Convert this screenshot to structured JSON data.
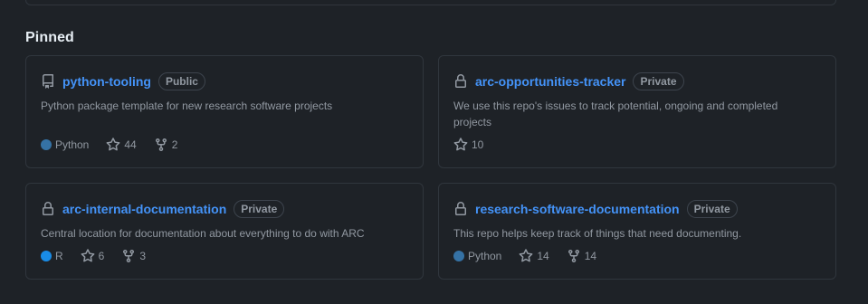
{
  "section": {
    "title": "Pinned"
  },
  "colors": {
    "link": "#4493f8",
    "python": "#3572A5",
    "r": "#198CE7",
    "muted": "#9198a1"
  },
  "repos": [
    {
      "name": "python-tooling",
      "visibility": "Public",
      "icon": "repo-icon",
      "description": "Python package template for new research software projects",
      "language": "Python",
      "language_color": "#3572A5",
      "stars": "44",
      "forks": "2"
    },
    {
      "name": "arc-opportunities-tracker",
      "visibility": "Private",
      "icon": "lock-icon",
      "description": "We use this repo's issues to track potential, ongoing and completed projects",
      "stars": "10"
    },
    {
      "name": "arc-internal-documentation",
      "visibility": "Private",
      "icon": "lock-icon",
      "description": "Central location for documentation about everything to do with ARC",
      "language": "R",
      "language_color": "#198CE7",
      "stars": "6",
      "forks": "3"
    },
    {
      "name": "research-software-documentation",
      "visibility": "Private",
      "icon": "lock-icon",
      "description": "This repo helps keep track of things that need documenting.",
      "language": "Python",
      "language_color": "#3572A5",
      "stars": "14",
      "forks": "14"
    }
  ]
}
